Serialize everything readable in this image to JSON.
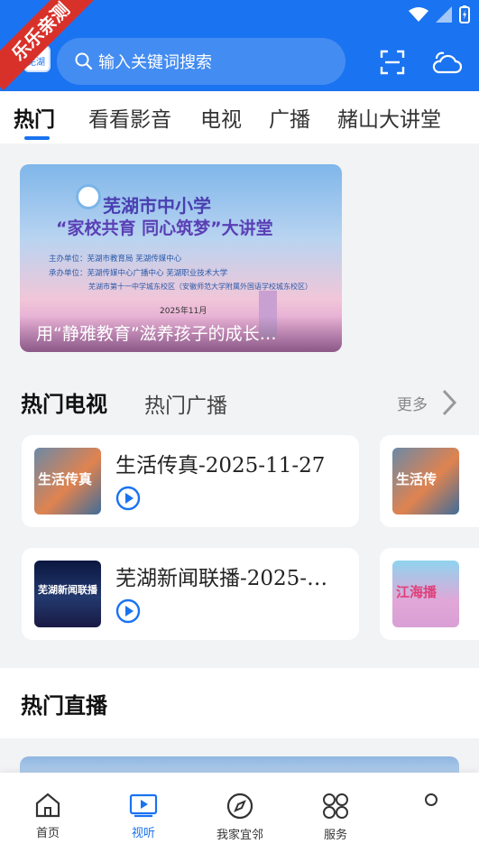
{
  "watermark": "乐乐亲测",
  "app_logo_text": "芜湖",
  "search": {
    "placeholder": "输入关键词搜索"
  },
  "tabs": [
    {
      "label": "热门"
    },
    {
      "label": "看看影音"
    },
    {
      "label": "电视"
    },
    {
      "label": "广播"
    },
    {
      "label": "赭山大讲堂"
    }
  ],
  "banner": {
    "title_line1": "芜湖市中小学",
    "title_line2": "“家校共育 同心筑梦”大讲堂",
    "organizer": "主办单位：芜湖市教育局  芜湖传媒中心",
    "undertaker": "承办单位：芜湖传媒中心广播中心  芜湖职业技术大学",
    "co_organizer": "芜湖市第十一中学城东校区（安徽师范大学附属外国语学校城东校区）",
    "date": "2025年11月",
    "caption": "用“静雅教育”滋养孩子的成长…"
  },
  "section": {
    "active_tab": "热门电视",
    "other_tab": "热门广播",
    "more_label": "更多"
  },
  "cards": [
    {
      "title": "生活传真-2025-11-27",
      "thumb_label": "生活传真"
    },
    {
      "title": "芜湖新闻联播-2025-…",
      "thumb_label": "芜湖新闻联播"
    }
  ],
  "side_cards": [
    {
      "thumb_label": "生活传"
    },
    {
      "thumb_label": "江海播"
    }
  ],
  "live": {
    "title": "热门直播"
  },
  "bottom_nav": [
    {
      "label": "首页"
    },
    {
      "label": "视听"
    },
    {
      "label": "我家宜邻"
    },
    {
      "label": "服务"
    }
  ],
  "colors": {
    "brand": "#1a73f0",
    "watermark": "#d8312a"
  }
}
